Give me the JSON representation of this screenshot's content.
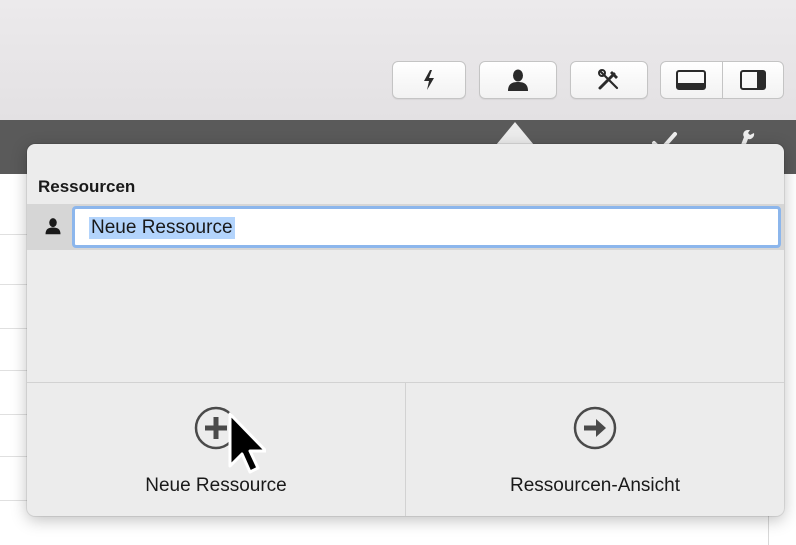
{
  "toolbar": {
    "buttons": [
      "lightning-icon",
      "person-icon",
      "tools-icon",
      "bottom-panel-icon",
      "side-panel-icon"
    ]
  },
  "popover": {
    "title": "Ressourcen",
    "resource_input": "Neue Ressource",
    "actions": {
      "new_resource_label": "Neue Ressource",
      "view_label": "Ressourcen-Ansicht"
    }
  }
}
